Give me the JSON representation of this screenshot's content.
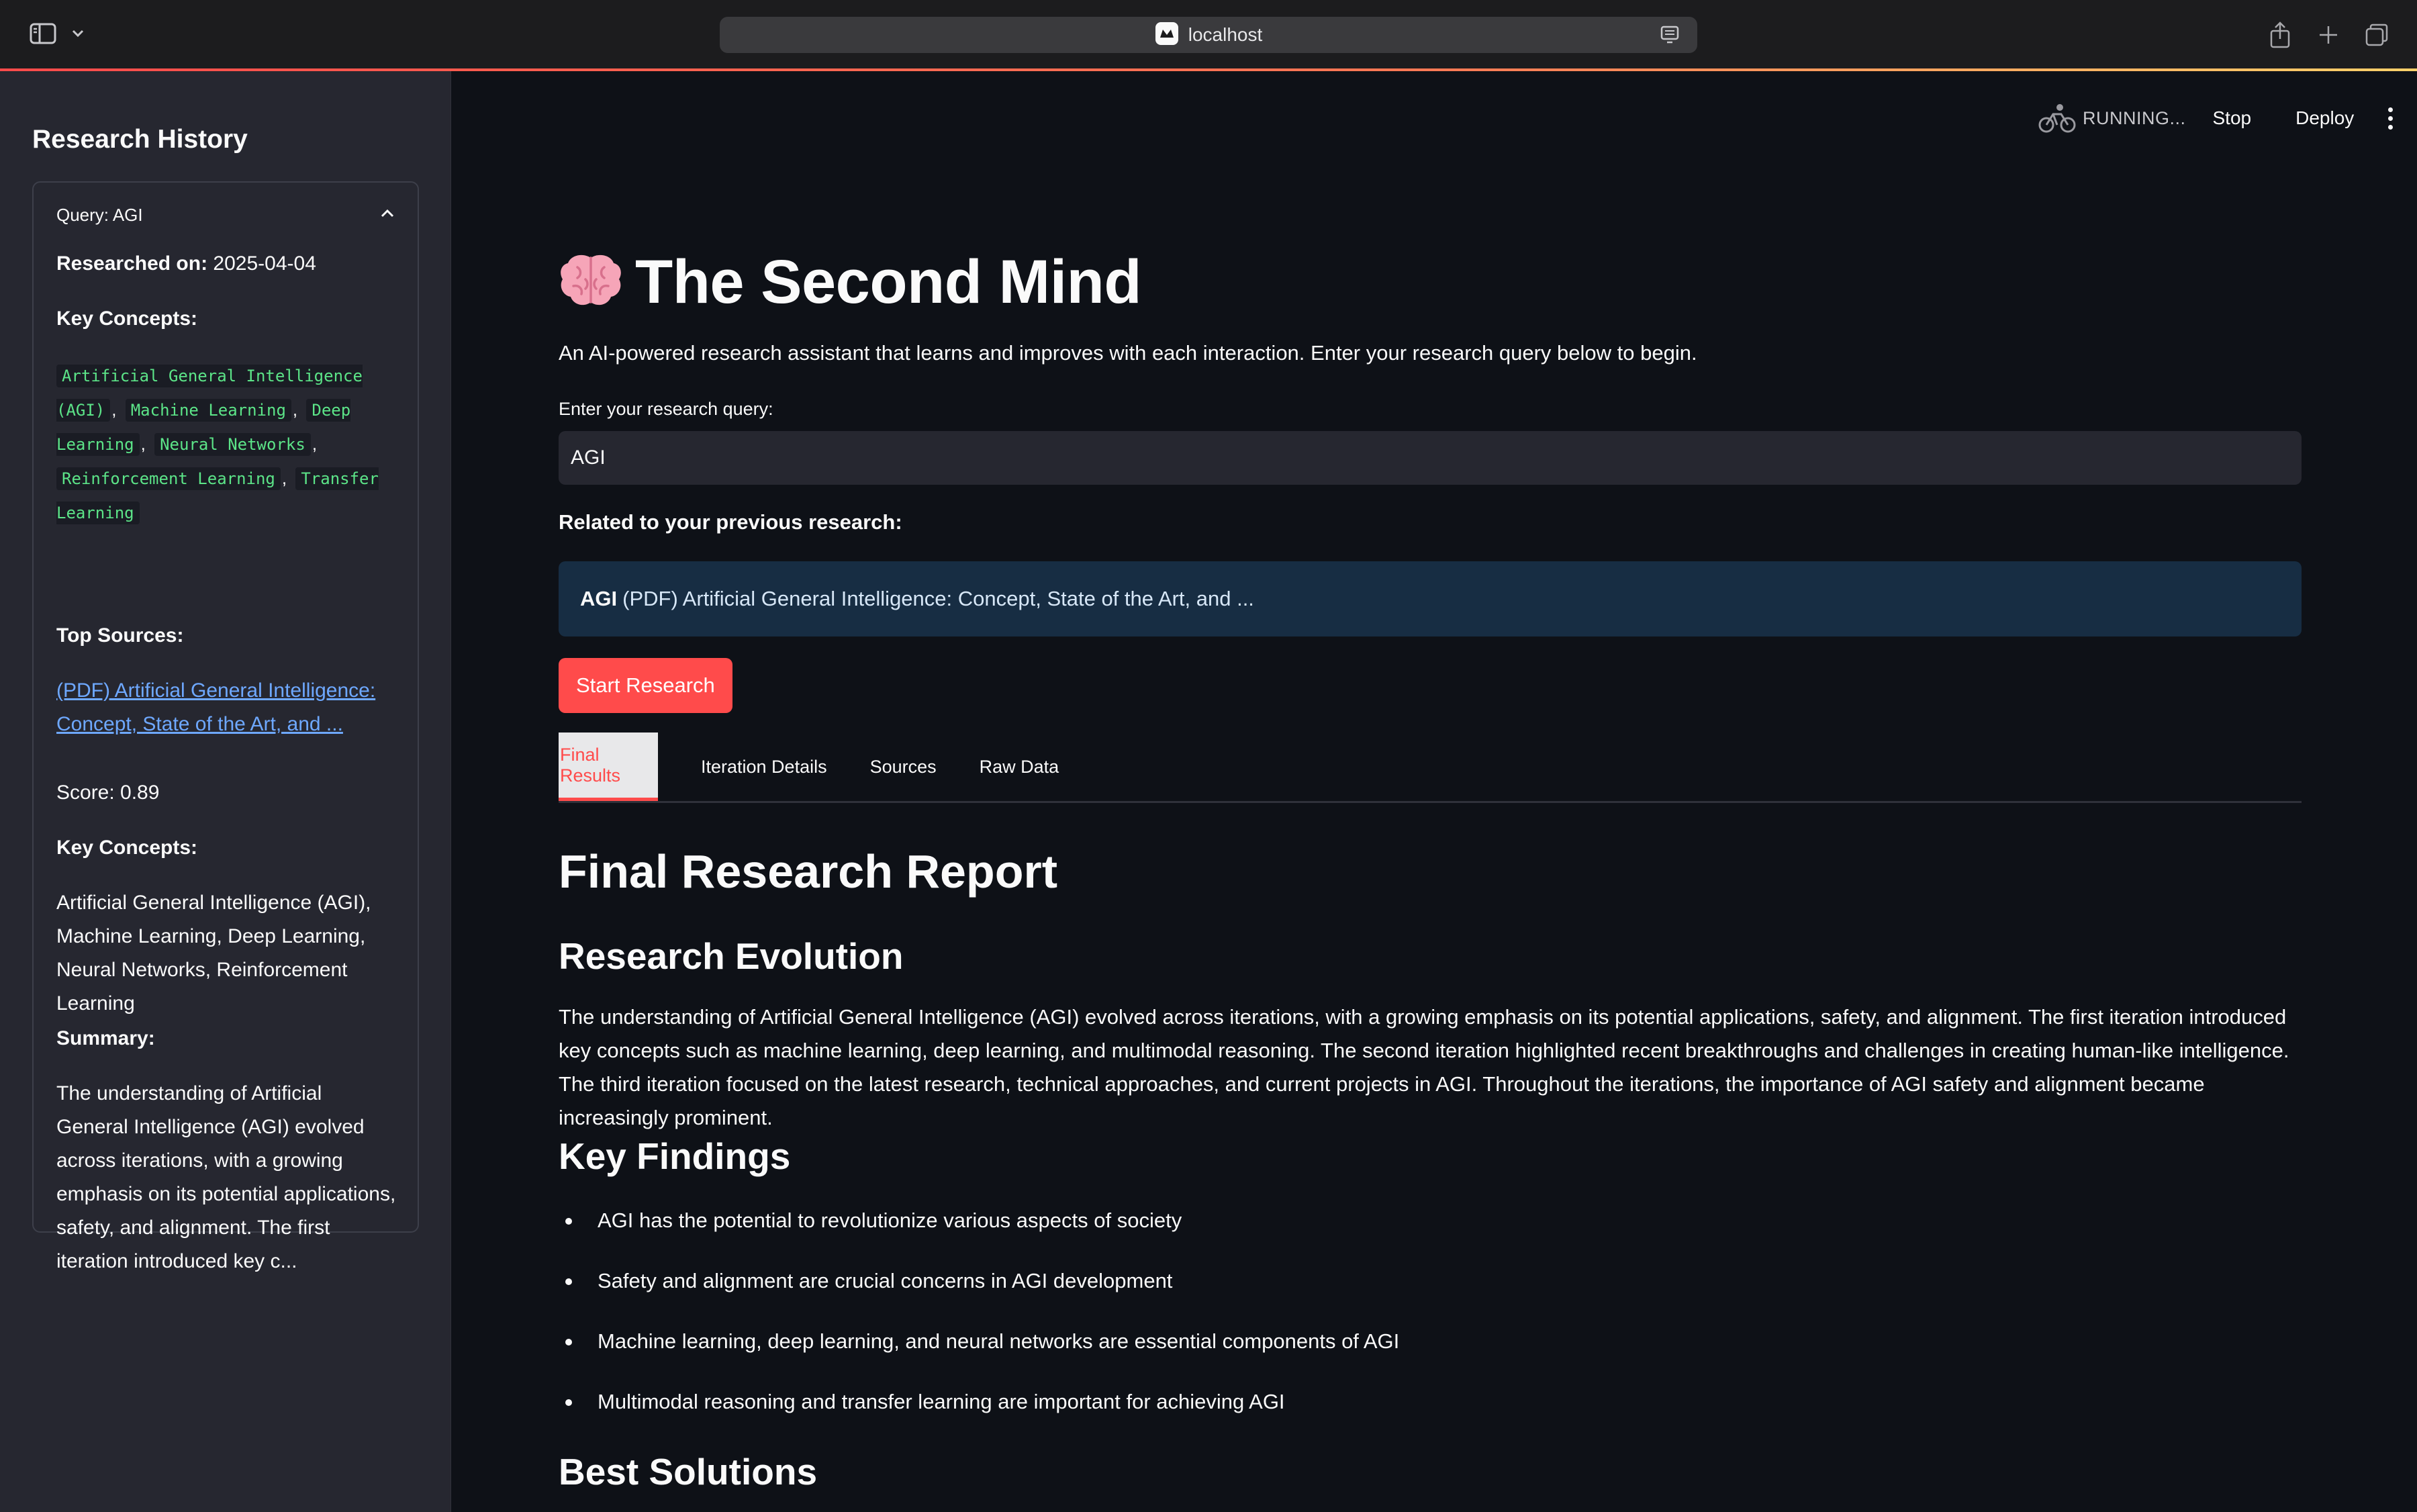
{
  "browser": {
    "url": "localhost"
  },
  "sidebar": {
    "title": "Research History",
    "card": {
      "query_label": "Query: AGI",
      "researched_label": "Researched on:",
      "researched_date": "2025-04-04",
      "key_concepts_label": "Key Concepts:",
      "key_concepts": [
        "Artificial General Intelligence (AGI)",
        "Machine Learning",
        "Deep Learning",
        "Neural Networks",
        "Reinforcement Learning",
        "Transfer Learning"
      ],
      "top_sources_label": "Top Sources:",
      "source_link": "(PDF) Artificial General Intelligence: Concept, State of the Art, and ...",
      "score": "Score: 0.89",
      "source_key_concepts_label": "Key Concepts:",
      "source_key_concepts": "Artificial General Intelligence (AGI), Machine Learning, Deep Learning, Neural Networks, Reinforcement Learning",
      "summary_label": "Summary:",
      "summary": "The understanding of Artificial General Intelligence (AGI) evolved across iterations, with a growing emphasis on its potential applications, safety, and alignment. The first iteration introduced key c..."
    }
  },
  "toolbar": {
    "status": "RUNNING...",
    "stop": "Stop",
    "deploy": "Deploy"
  },
  "main": {
    "emoji": "🧠",
    "title": "The Second Mind",
    "intro": "An AI-powered research assistant that learns and improves with each interaction. Enter your research query below to begin.",
    "query_label": "Enter your research query:",
    "query_value": "AGI",
    "related_label": "Related to your previous research:",
    "related_query": "AGI",
    "related_title": "(PDF) Artificial General Intelligence: Concept, State of the Art, and ...",
    "start_button": "Start Research",
    "tabs": [
      "Final Results",
      "Iteration Details",
      "Sources",
      "Raw Data"
    ],
    "report_title": "Final Research Report",
    "evolution_title": "Research Evolution",
    "evolution_text": "The understanding of Artificial General Intelligence (AGI) evolved across iterations, with a growing emphasis on its potential applications, safety, and alignment. The first iteration introduced key concepts such as machine learning, deep learning, and multimodal reasoning. The second iteration highlighted recent breakthroughs and challenges in creating human-like intelligence. The third iteration focused on the latest research, technical approaches, and current projects in AGI. Throughout the iterations, the importance of AGI safety and alignment became increasingly prominent.",
    "findings_title": "Key Findings",
    "findings": [
      "AGI has the potential to revolutionize various aspects of society",
      "Safety and alignment are crucial concerns in AGI development",
      "Machine learning, deep learning, and neural networks are essential components of AGI",
      "Multimodal reasoning and transfer learning are important for achieving AGI"
    ],
    "solutions_title": "Best Solutions"
  },
  "colors": {
    "background": "#0e1117",
    "sidebar": "#262730",
    "accent": "#ff4b4b",
    "code_text": "#5ce488",
    "link": "#6ea8ff",
    "info_box": "#172d43"
  }
}
